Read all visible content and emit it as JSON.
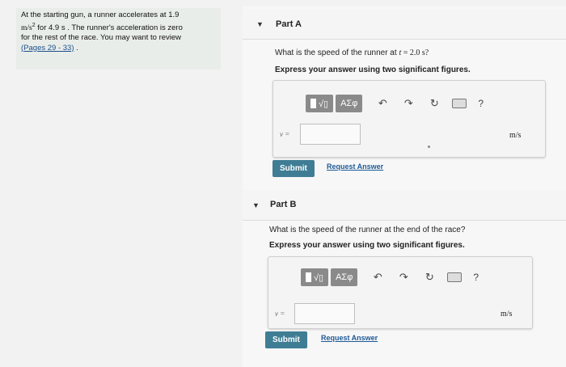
{
  "problem": {
    "line1": "At the starting gun, a runner accelerates at 1.9",
    "line2_unit": "m/s",
    "line2_exp": "2",
    "line2_rest": " for 4.9 s . The runner's acceleration is zero",
    "line3": "for the rest of the race. You may want to review",
    "link": "(Pages 29 - 33)",
    "after_link": " ."
  },
  "partA": {
    "title": "Part A",
    "question_prefix": "What is the speed of the runner at ",
    "question_var": "t",
    "question_eq": " = 2.0 s?",
    "instruction": "Express your answer using two significant figures.",
    "template_label": "√▯",
    "greek_label": "ΑΣφ",
    "help": "?",
    "var_label": "v =",
    "unit": "m/s",
    "submit": "Submit",
    "request": "Request Answer"
  },
  "partB": {
    "title": "Part B",
    "question": "What is the speed of the runner at the end of the race?",
    "instruction": "Express your answer using two significant figures.",
    "template_label": "√▯",
    "greek_label": "ΑΣφ",
    "help": "?",
    "var_label": "v =",
    "unit": "m/s",
    "submit": "Submit",
    "request": "Request Answer"
  },
  "colors": {
    "submit": "#3f7d95",
    "link": "#1f5a96",
    "panel": "#e9edea"
  },
  "icons": [
    "undo-icon",
    "redo-icon",
    "reset-icon",
    "keyboard-icon",
    "help-icon"
  ]
}
